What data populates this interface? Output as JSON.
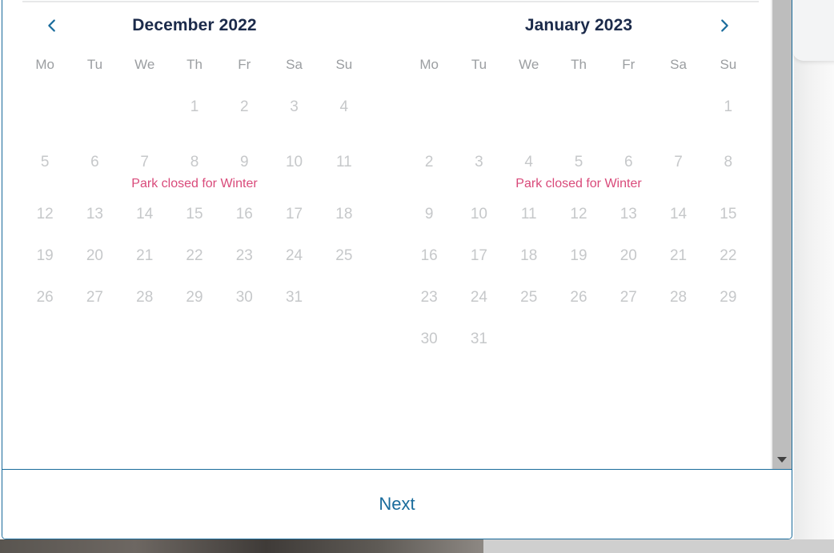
{
  "dialog": {
    "scrollbar": {
      "arrow_down_icon": "triangle-down-icon"
    },
    "footer": {
      "next_label": "Next"
    }
  },
  "colors": {
    "accent_blue": "#1a6c9c",
    "title_navy": "#1b2a4a",
    "day_gray": "#c6c8ca",
    "weekday_gray": "#9b9ea1",
    "note_pink": "#d94a7a",
    "scrollbar_thumb": "#bdbdbd"
  },
  "weekdays": [
    "Mo",
    "Tu",
    "We",
    "Th",
    "Fr",
    "Sa",
    "Su"
  ],
  "calendars": [
    {
      "title": "December 2022",
      "prev_icon": "chevron-left-icon",
      "has_prev": true,
      "has_next": false,
      "weeks": [
        {
          "days": [
            "",
            "",
            "",
            "1",
            "2",
            "3",
            "4"
          ],
          "note": ""
        },
        {
          "days": [
            "5",
            "6",
            "7",
            "8",
            "9",
            "10",
            "11"
          ],
          "note": "Park closed for Winter"
        },
        {
          "days": [
            "12",
            "13",
            "14",
            "15",
            "16",
            "17",
            "18"
          ],
          "note": ""
        },
        {
          "days": [
            "19",
            "20",
            "21",
            "22",
            "23",
            "24",
            "25"
          ],
          "note": ""
        },
        {
          "days": [
            "26",
            "27",
            "28",
            "29",
            "30",
            "31",
            ""
          ],
          "note": ""
        }
      ]
    },
    {
      "title": "January 2023",
      "next_icon": "chevron-right-icon",
      "has_prev": false,
      "has_next": true,
      "weeks": [
        {
          "days": [
            "",
            "",
            "",
            "",
            "",
            "",
            "1"
          ],
          "note": ""
        },
        {
          "days": [
            "2",
            "3",
            "4",
            "5",
            "6",
            "7",
            "8"
          ],
          "note": "Park closed for Winter"
        },
        {
          "days": [
            "9",
            "10",
            "11",
            "12",
            "13",
            "14",
            "15"
          ],
          "note": ""
        },
        {
          "days": [
            "16",
            "17",
            "18",
            "19",
            "20",
            "21",
            "22"
          ],
          "note": ""
        },
        {
          "days": [
            "23",
            "24",
            "25",
            "26",
            "27",
            "28",
            "29"
          ],
          "note": ""
        },
        {
          "days": [
            "30",
            "31",
            "",
            "",
            "",
            "",
            ""
          ],
          "note": ""
        }
      ]
    }
  ]
}
